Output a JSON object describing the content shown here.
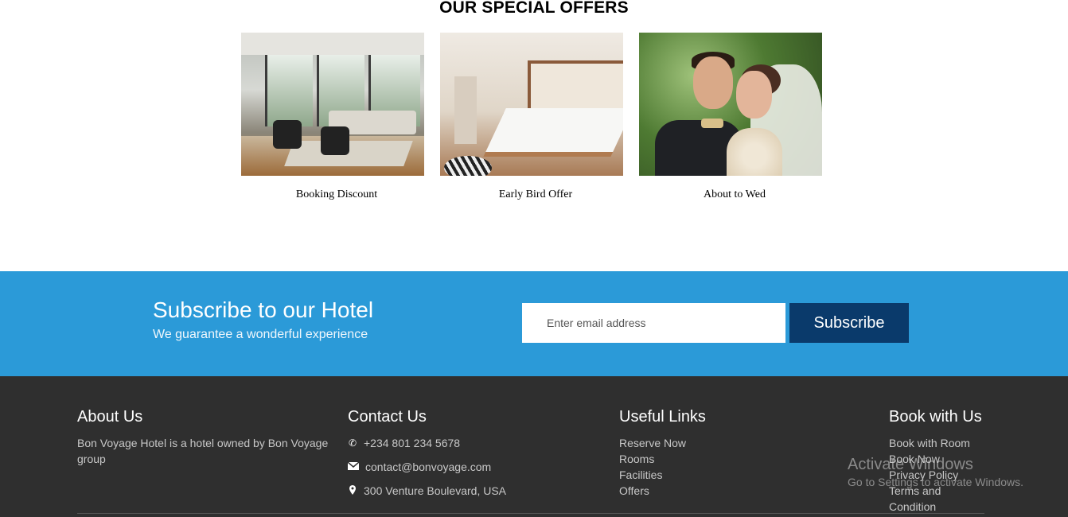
{
  "offers": {
    "title": "OUR SPECIAL OFFERS",
    "items": [
      {
        "caption": "Booking Discount"
      },
      {
        "caption": "Early Bird Offer"
      },
      {
        "caption": "About to Wed"
      }
    ]
  },
  "subscribe": {
    "title": "Subscribe to our Hotel",
    "subtitle": "We guarantee a wonderful experience",
    "email_placeholder": "Enter email address",
    "button_label": "Subscribe",
    "background_color": "#2b9ad8",
    "button_color": "#0a3a6b"
  },
  "footer": {
    "background_color": "#2f2f2f",
    "about": {
      "heading": "About Us",
      "text": "Bon Voyage Hotel is a hotel owned by Bon Voyage group"
    },
    "contact": {
      "heading": "Contact Us",
      "phone": "+234 801 234 5678",
      "email": "contact@bonvoyage.com",
      "address": "300 Venture Boulevard, USA",
      "icons": [
        "phone-icon",
        "envelope-icon",
        "map-marker-icon"
      ]
    },
    "useful_links": {
      "heading": "Useful Links",
      "links": [
        "Reserve Now",
        "Rooms",
        "Facilities",
        "Offers"
      ]
    },
    "book": {
      "heading": "Book with Us",
      "links": [
        "Book with Room",
        "Book Now",
        "Privacy Policy",
        "Terms and",
        "Condition"
      ]
    }
  },
  "watermark": {
    "title": "Activate Windows",
    "subtitle": "Go to Settings to activate Windows."
  }
}
